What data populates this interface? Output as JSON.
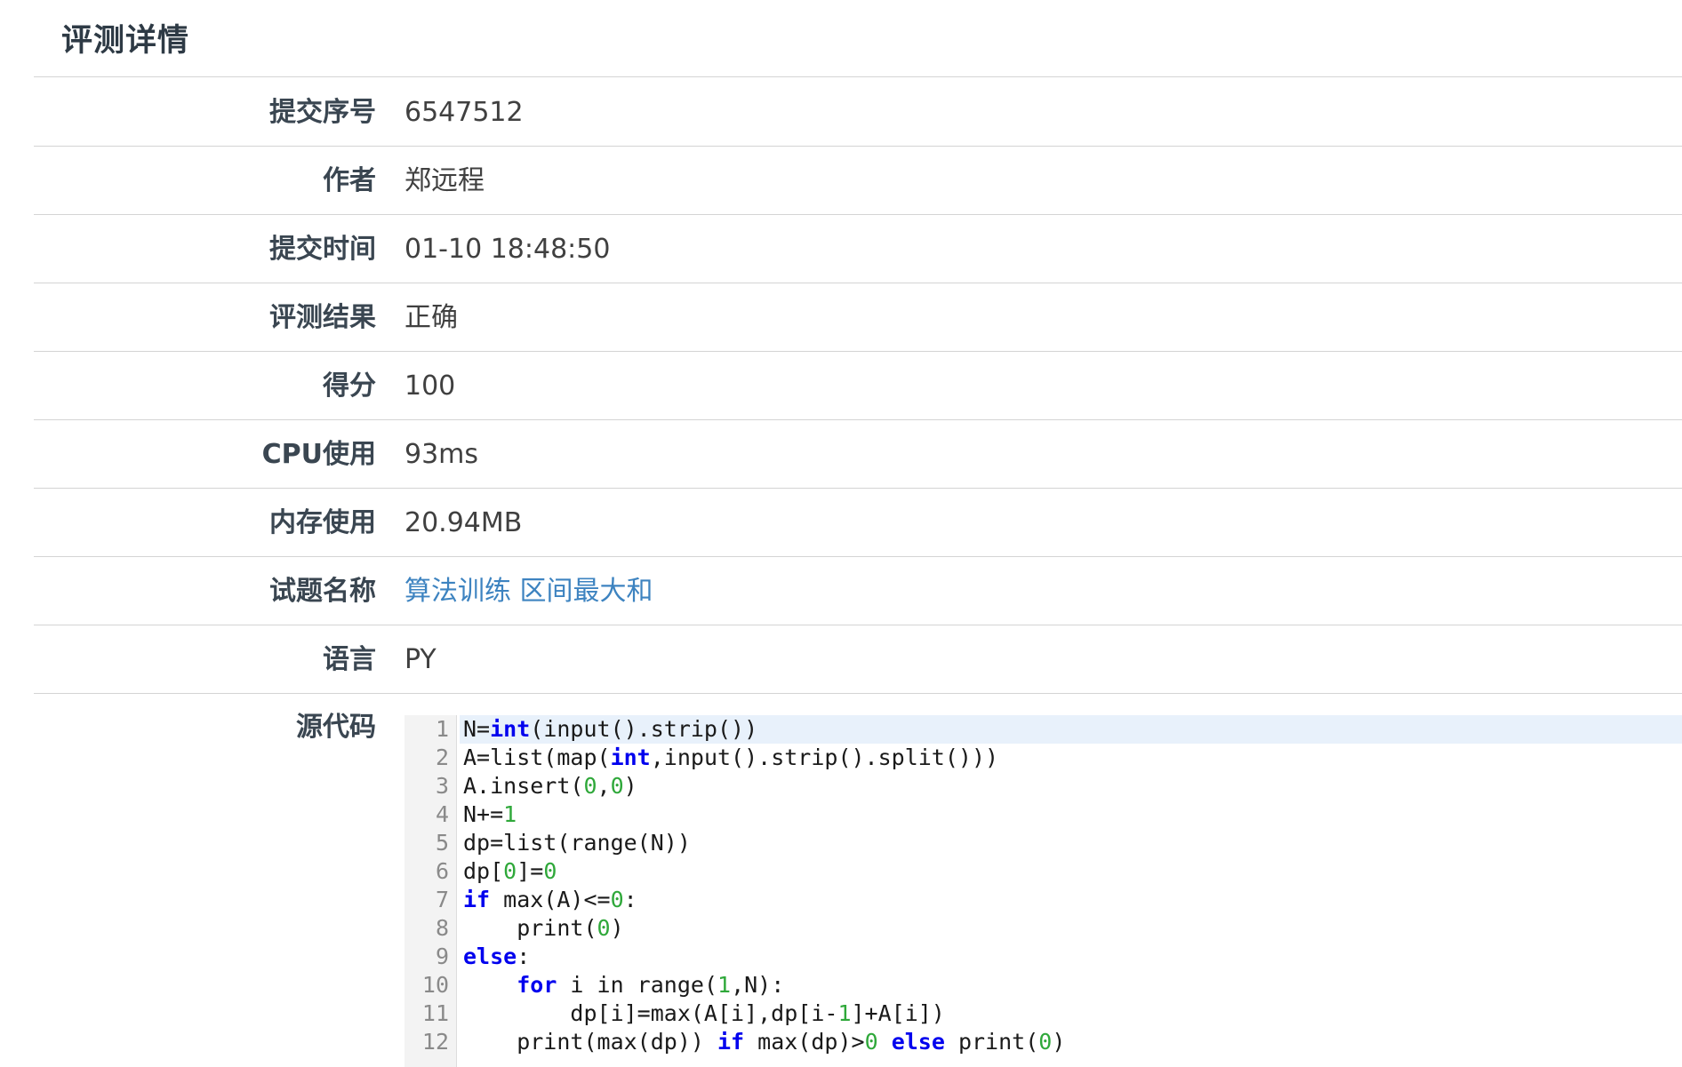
{
  "page": {
    "title": "评测详情"
  },
  "details": [
    {
      "label": "提交序号",
      "value": "6547512"
    },
    {
      "label": "作者",
      "value": "郑远程"
    },
    {
      "label": "提交时间",
      "value": "01-10 18:48:50"
    },
    {
      "label": "评测结果",
      "value": "正确"
    },
    {
      "label": "得分",
      "value": "100"
    },
    {
      "label": "CPU使用",
      "value": "93ms"
    },
    {
      "label": "内存使用",
      "value": "20.94MB"
    },
    {
      "label": "试题名称",
      "value": "算法训练 区间最大和"
    },
    {
      "label": "语言",
      "value": "PY"
    }
  ],
  "source": {
    "label": "源代码",
    "lines": [
      {
        "no": "1",
        "tokens": [
          {
            "t": "N="
          },
          {
            "t": "int",
            "c": "kw"
          },
          {
            "t": "(input().strip())"
          }
        ]
      },
      {
        "no": "2",
        "tokens": [
          {
            "t": "A=list(map("
          },
          {
            "t": "int",
            "c": "kw"
          },
          {
            "t": ",input().strip().split()))"
          }
        ]
      },
      {
        "no": "3",
        "tokens": [
          {
            "t": "A.insert("
          },
          {
            "t": "0",
            "c": "num"
          },
          {
            "t": ","
          },
          {
            "t": "0",
            "c": "num"
          },
          {
            "t": ")"
          }
        ]
      },
      {
        "no": "4",
        "tokens": [
          {
            "t": "N+="
          },
          {
            "t": "1",
            "c": "num"
          }
        ]
      },
      {
        "no": "5",
        "tokens": [
          {
            "t": "dp=list(range(N))"
          }
        ]
      },
      {
        "no": "6",
        "tokens": [
          {
            "t": "dp["
          },
          {
            "t": "0",
            "c": "num"
          },
          {
            "t": "]="
          },
          {
            "t": "0",
            "c": "num"
          }
        ]
      },
      {
        "no": "7",
        "tokens": [
          {
            "t": "if",
            "c": "kw"
          },
          {
            "t": " max(A)<="
          },
          {
            "t": "0",
            "c": "num"
          },
          {
            "t": ":"
          }
        ]
      },
      {
        "no": "8",
        "tokens": [
          {
            "t": "    print("
          },
          {
            "t": "0",
            "c": "num"
          },
          {
            "t": ")"
          }
        ]
      },
      {
        "no": "9",
        "tokens": [
          {
            "t": "else",
            "c": "kw"
          },
          {
            "t": ":"
          }
        ]
      },
      {
        "no": "10",
        "tokens": [
          {
            "t": "    "
          },
          {
            "t": "for",
            "c": "kw"
          },
          {
            "t": " i in range("
          },
          {
            "t": "1",
            "c": "num"
          },
          {
            "t": ",N):"
          }
        ]
      },
      {
        "no": "11",
        "tokens": [
          {
            "t": "        dp[i]=max(A[i],dp[i-"
          },
          {
            "t": "1",
            "c": "num"
          },
          {
            "t": "]+A[i])"
          }
        ]
      },
      {
        "no": "12",
        "tokens": [
          {
            "t": "    print(max(dp)) "
          },
          {
            "t": "if",
            "c": "kw"
          },
          {
            "t": " max(dp)>"
          },
          {
            "t": "0",
            "c": "num"
          },
          {
            "t": " "
          },
          {
            "t": "else",
            "c": "kw"
          },
          {
            "t": " print("
          },
          {
            "t": "0",
            "c": "num"
          },
          {
            "t": ")"
          }
        ]
      }
    ]
  }
}
